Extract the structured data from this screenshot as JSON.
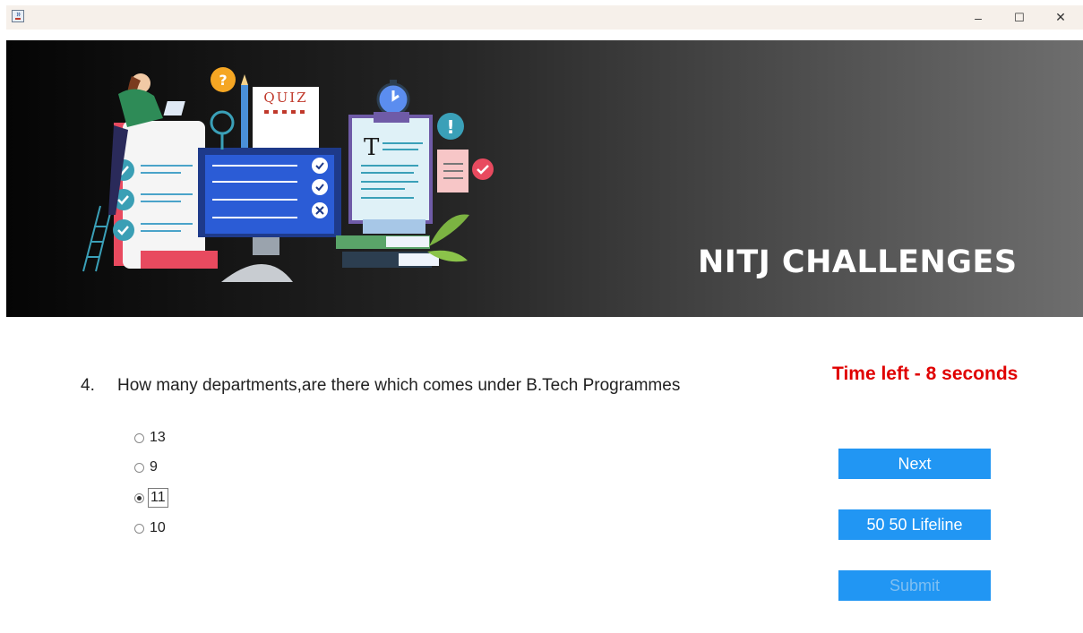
{
  "window": {
    "minimize_glyph": "–",
    "maximize_glyph": "☐",
    "close_glyph": "✕"
  },
  "banner": {
    "title": "NITJ CHALLENGES",
    "quiz_text": "QUIZ",
    "doc_letter": "T",
    "question_mark": "?",
    "exclamation": "!"
  },
  "question": {
    "number": "4.",
    "text": "How many departments,are there which comes under B.Tech Programmes"
  },
  "timer": {
    "text": "Time left - 8 seconds",
    "color": "#e00000"
  },
  "options": [
    {
      "label": "13",
      "selected": false
    },
    {
      "label": "9",
      "selected": false
    },
    {
      "label": "11",
      "selected": true
    },
    {
      "label": "10",
      "selected": false
    }
  ],
  "buttons": {
    "next": "Next",
    "lifeline": "50 50 Lifeline",
    "submit": "Submit"
  },
  "colors": {
    "button": "#2196f3",
    "banner_dark": "#050505",
    "banner_light": "#6e6e6e"
  }
}
